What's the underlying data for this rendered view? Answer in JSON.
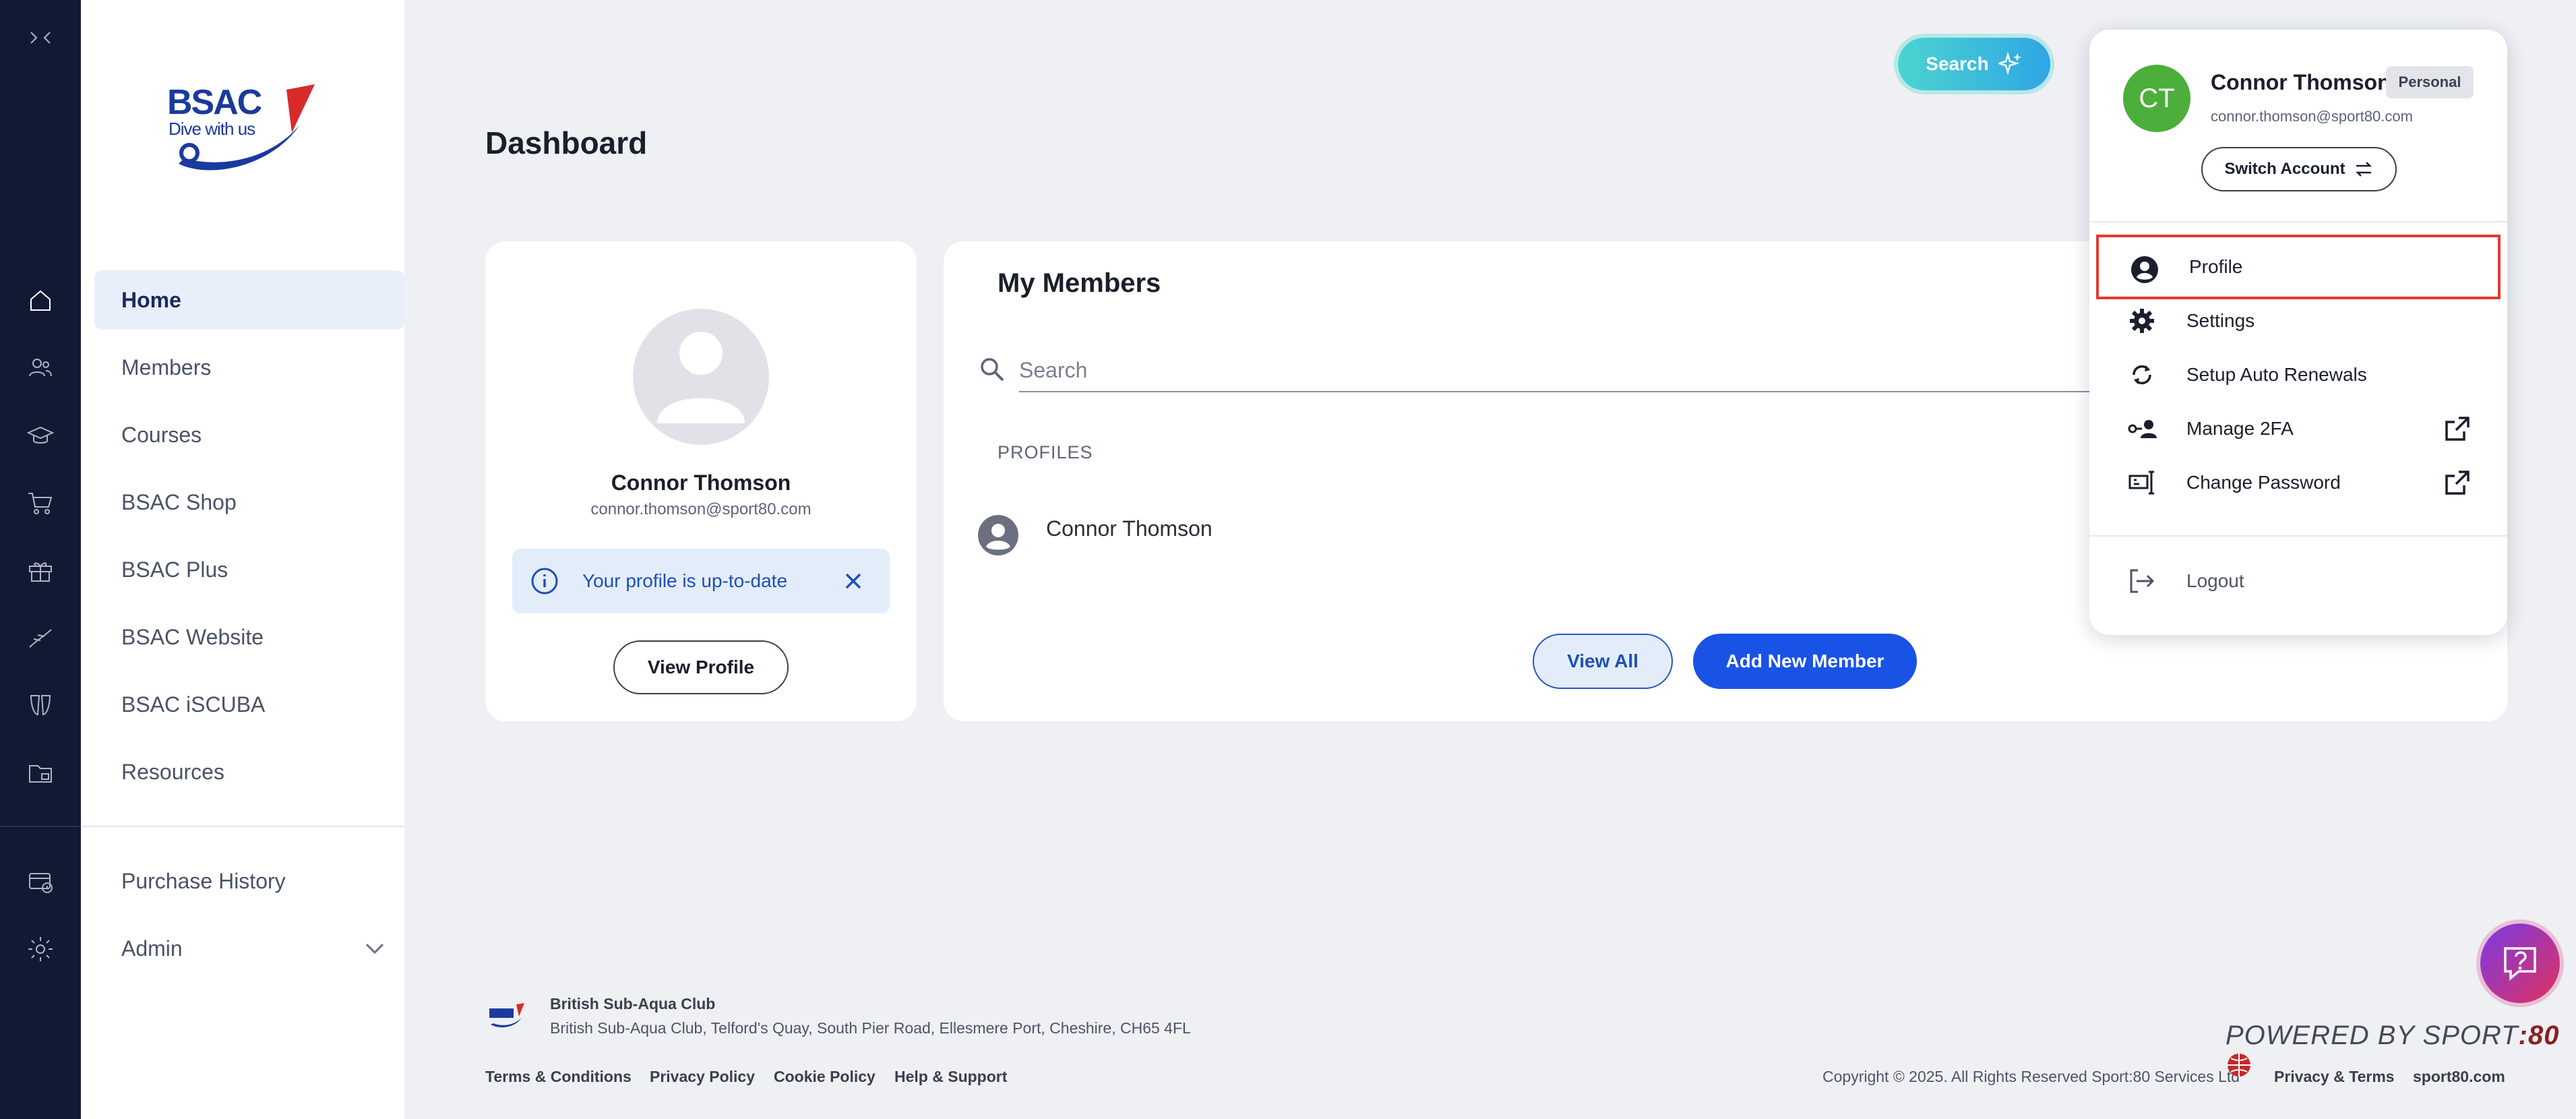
{
  "sidebar": {
    "logo_text": "BSAC",
    "logo_tagline": "Dive with us",
    "items": [
      {
        "label": "Home"
      },
      {
        "label": "Members"
      },
      {
        "label": "Courses"
      },
      {
        "label": "BSAC Shop"
      },
      {
        "label": "BSAC Plus"
      },
      {
        "label": "BSAC Website"
      },
      {
        "label": "BSAC iSCUBA"
      },
      {
        "label": "Resources"
      },
      {
        "label": "Purchase History"
      },
      {
        "label": "Admin"
      }
    ]
  },
  "header": {
    "search_label": "Search",
    "page_title": "Dashboard"
  },
  "profile_card": {
    "name": "Connor Thomson",
    "email": "connor.thomson@sport80.com",
    "notice": "Your profile is up-to-date",
    "view_profile": "View Profile"
  },
  "members": {
    "title": "My Members",
    "search_placeholder": "Search",
    "section": "PROFILES",
    "rows": [
      {
        "name": "Connor Thomson"
      }
    ],
    "view_all": "View All",
    "add_new": "Add New Member"
  },
  "account_menu": {
    "initials": "CT",
    "name": "Connor Thomson",
    "badge": "Personal",
    "email": "connor.thomson@sport80.com",
    "switch_account": "Switch Account",
    "items": [
      {
        "label": "Profile"
      },
      {
        "label": "Settings"
      },
      {
        "label": "Setup Auto Renewals"
      },
      {
        "label": "Manage 2FA"
      },
      {
        "label": "Change Password"
      },
      {
        "label": "Logout"
      }
    ]
  },
  "footer": {
    "org": "British Sub-Aqua Club",
    "address": "British Sub-Aqua Club, Telford's Quay, South Pier Road, Ellesmere Port, Cheshire, CH65 4FL",
    "links": [
      "Terms & Conditions",
      "Privacy Policy",
      "Cookie Policy",
      "Help & Support"
    ],
    "copyright": "Copyright © 2025. All Rights Reserved Sport:80 Services Ltd",
    "privacy_terms": "Privacy & Terms",
    "site": "sport80.com",
    "powered_prefix": "POWERED BY SPORT",
    "powered_suffix": ":80"
  },
  "colors": {
    "rail": "#121a33",
    "primary": "#1953e6",
    "highlight": "#e13a34",
    "avatar": "#4cae3b"
  }
}
